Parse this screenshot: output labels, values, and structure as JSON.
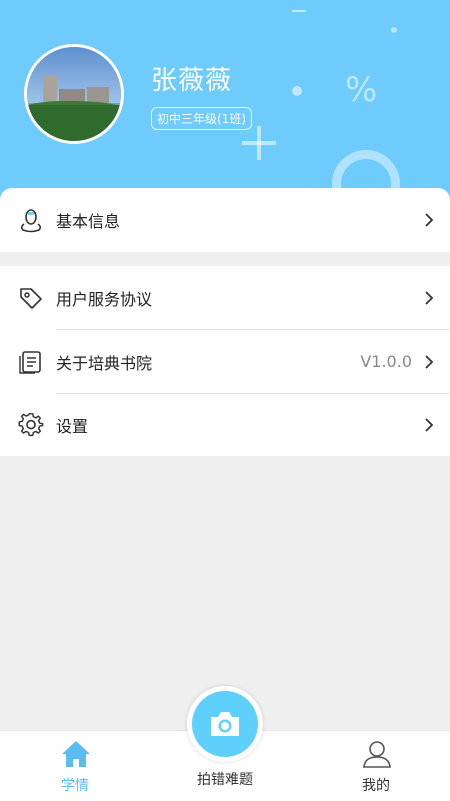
{
  "profile": {
    "name": "张薇薇",
    "class_label": "初中三年级(1班)"
  },
  "menu": {
    "basic_info": "基本信息",
    "user_agreement": "用户服务协议",
    "about": "关于培典书院",
    "about_version": "V1.0.0",
    "settings": "设置"
  },
  "tabs": {
    "study": "学情",
    "camera": "拍错难题",
    "mine": "我的"
  },
  "colors": {
    "header_bg": "#6fcbfb",
    "accent": "#5bbcf2",
    "camera": "#5fd0fb"
  }
}
